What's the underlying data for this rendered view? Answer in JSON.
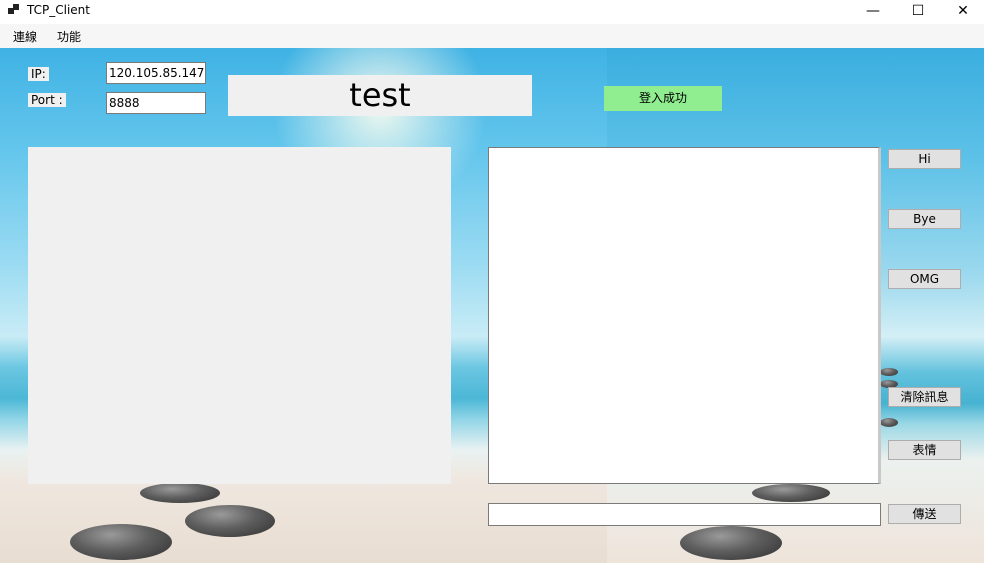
{
  "window": {
    "title": "TCP_Client",
    "minimize": "—",
    "maximize": "☐",
    "close": "✕"
  },
  "menu": {
    "items": [
      "連線",
      "功能"
    ]
  },
  "connection": {
    "ip_label": "IP:",
    "ip_value": "120.105.85.147",
    "port_label": "Port :",
    "port_value": "8888"
  },
  "user_name": "test",
  "status_text": "登入成功",
  "buttons": {
    "hi": "Hi",
    "bye": "Bye",
    "omg": "OMG",
    "clear": "清除訊息",
    "emoji": "表情",
    "send": "傳送"
  },
  "colors": {
    "status_bg": "#90ee90",
    "panel_bg": "#f0f0f0",
    "button_bg": "#e1e1e1"
  }
}
